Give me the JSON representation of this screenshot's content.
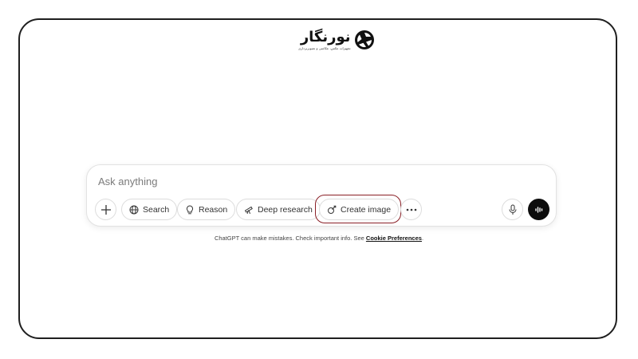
{
  "logo": {
    "text": "نورنگار",
    "subtitle": "تجهیزات عکس، عکاسی و تصویربرداری"
  },
  "composer": {
    "placeholder": "Ask anything",
    "buttons": {
      "search": "Search",
      "reason": "Reason",
      "deep_research": "Deep research",
      "create_image": "Create image"
    }
  },
  "footer": {
    "disclaimer": "ChatGPT can make mistakes. Check important info. See",
    "link": "Cookie Preferences",
    "period": "."
  },
  "colors": {
    "highlight": "#8a1f26",
    "voice_button": "#0d0d0d",
    "frame": "#1f1f1f"
  }
}
